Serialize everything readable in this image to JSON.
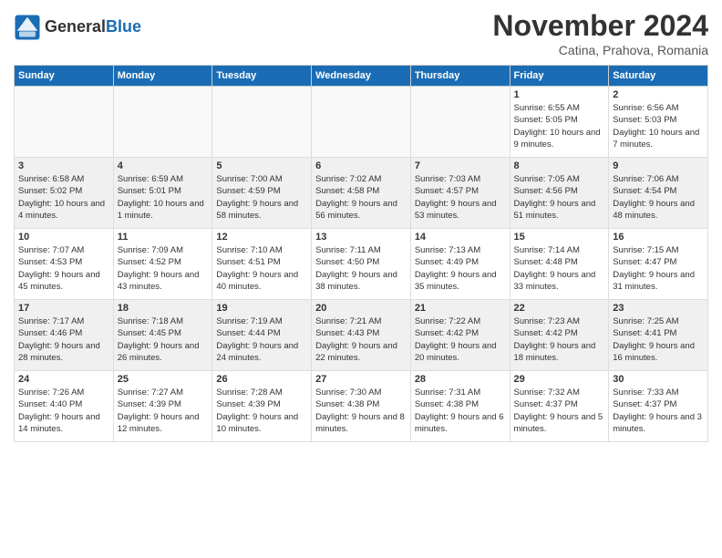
{
  "header": {
    "logo_text_general": "General",
    "logo_text_blue": "Blue",
    "month_title": "November 2024",
    "location": "Catina, Prahova, Romania"
  },
  "days_of_week": [
    "Sunday",
    "Monday",
    "Tuesday",
    "Wednesday",
    "Thursday",
    "Friday",
    "Saturday"
  ],
  "weeks": [
    [
      {
        "day": "",
        "info": "",
        "empty": true
      },
      {
        "day": "",
        "info": "",
        "empty": true
      },
      {
        "day": "",
        "info": "",
        "empty": true
      },
      {
        "day": "",
        "info": "",
        "empty": true
      },
      {
        "day": "",
        "info": "",
        "empty": true
      },
      {
        "day": "1",
        "info": "Sunrise: 6:55 AM\nSunset: 5:05 PM\nDaylight: 10 hours and 9 minutes."
      },
      {
        "day": "2",
        "info": "Sunrise: 6:56 AM\nSunset: 5:03 PM\nDaylight: 10 hours and 7 minutes."
      }
    ],
    [
      {
        "day": "3",
        "info": "Sunrise: 6:58 AM\nSunset: 5:02 PM\nDaylight: 10 hours and 4 minutes."
      },
      {
        "day": "4",
        "info": "Sunrise: 6:59 AM\nSunset: 5:01 PM\nDaylight: 10 hours and 1 minute."
      },
      {
        "day": "5",
        "info": "Sunrise: 7:00 AM\nSunset: 4:59 PM\nDaylight: 9 hours and 58 minutes."
      },
      {
        "day": "6",
        "info": "Sunrise: 7:02 AM\nSunset: 4:58 PM\nDaylight: 9 hours and 56 minutes."
      },
      {
        "day": "7",
        "info": "Sunrise: 7:03 AM\nSunset: 4:57 PM\nDaylight: 9 hours and 53 minutes."
      },
      {
        "day": "8",
        "info": "Sunrise: 7:05 AM\nSunset: 4:56 PM\nDaylight: 9 hours and 51 minutes."
      },
      {
        "day": "9",
        "info": "Sunrise: 7:06 AM\nSunset: 4:54 PM\nDaylight: 9 hours and 48 minutes."
      }
    ],
    [
      {
        "day": "10",
        "info": "Sunrise: 7:07 AM\nSunset: 4:53 PM\nDaylight: 9 hours and 45 minutes."
      },
      {
        "day": "11",
        "info": "Sunrise: 7:09 AM\nSunset: 4:52 PM\nDaylight: 9 hours and 43 minutes."
      },
      {
        "day": "12",
        "info": "Sunrise: 7:10 AM\nSunset: 4:51 PM\nDaylight: 9 hours and 40 minutes."
      },
      {
        "day": "13",
        "info": "Sunrise: 7:11 AM\nSunset: 4:50 PM\nDaylight: 9 hours and 38 minutes."
      },
      {
        "day": "14",
        "info": "Sunrise: 7:13 AM\nSunset: 4:49 PM\nDaylight: 9 hours and 35 minutes."
      },
      {
        "day": "15",
        "info": "Sunrise: 7:14 AM\nSunset: 4:48 PM\nDaylight: 9 hours and 33 minutes."
      },
      {
        "day": "16",
        "info": "Sunrise: 7:15 AM\nSunset: 4:47 PM\nDaylight: 9 hours and 31 minutes."
      }
    ],
    [
      {
        "day": "17",
        "info": "Sunrise: 7:17 AM\nSunset: 4:46 PM\nDaylight: 9 hours and 28 minutes."
      },
      {
        "day": "18",
        "info": "Sunrise: 7:18 AM\nSunset: 4:45 PM\nDaylight: 9 hours and 26 minutes."
      },
      {
        "day": "19",
        "info": "Sunrise: 7:19 AM\nSunset: 4:44 PM\nDaylight: 9 hours and 24 minutes."
      },
      {
        "day": "20",
        "info": "Sunrise: 7:21 AM\nSunset: 4:43 PM\nDaylight: 9 hours and 22 minutes."
      },
      {
        "day": "21",
        "info": "Sunrise: 7:22 AM\nSunset: 4:42 PM\nDaylight: 9 hours and 20 minutes."
      },
      {
        "day": "22",
        "info": "Sunrise: 7:23 AM\nSunset: 4:42 PM\nDaylight: 9 hours and 18 minutes."
      },
      {
        "day": "23",
        "info": "Sunrise: 7:25 AM\nSunset: 4:41 PM\nDaylight: 9 hours and 16 minutes."
      }
    ],
    [
      {
        "day": "24",
        "info": "Sunrise: 7:26 AM\nSunset: 4:40 PM\nDaylight: 9 hours and 14 minutes."
      },
      {
        "day": "25",
        "info": "Sunrise: 7:27 AM\nSunset: 4:39 PM\nDaylight: 9 hours and 12 minutes."
      },
      {
        "day": "26",
        "info": "Sunrise: 7:28 AM\nSunset: 4:39 PM\nDaylight: 9 hours and 10 minutes."
      },
      {
        "day": "27",
        "info": "Sunrise: 7:30 AM\nSunset: 4:38 PM\nDaylight: 9 hours and 8 minutes."
      },
      {
        "day": "28",
        "info": "Sunrise: 7:31 AM\nSunset: 4:38 PM\nDaylight: 9 hours and 6 minutes."
      },
      {
        "day": "29",
        "info": "Sunrise: 7:32 AM\nSunset: 4:37 PM\nDaylight: 9 hours and 5 minutes."
      },
      {
        "day": "30",
        "info": "Sunrise: 7:33 AM\nSunset: 4:37 PM\nDaylight: 9 hours and 3 minutes."
      }
    ]
  ]
}
